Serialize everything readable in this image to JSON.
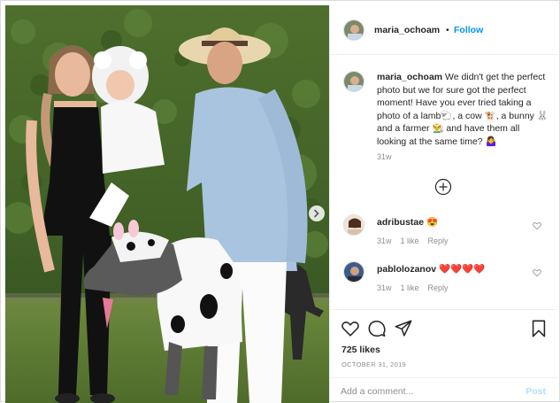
{
  "post": {
    "username": "maria_ochoam",
    "follow_separator": "•",
    "follow_label": "Follow",
    "caption_text": "We didn't get the perfect photo but we for sure got the perfect moment! Have you ever tried taking a photo of a lamb🐑, a cow 🐮, a bunny 🐰 and a farmer 👨‍🌾 and have them all looking at the same time? 🤷‍♀️",
    "caption_time": "31w",
    "likes": "725 likes",
    "date": "OCTOBER 31, 2019"
  },
  "comments": [
    {
      "username": "adribustae",
      "text": "😍",
      "time": "31w",
      "likes": "1 like",
      "reply": "Reply"
    },
    {
      "username": "pablolozanov",
      "text": "❤️❤️❤️❤️",
      "time": "31w",
      "likes": "1 like",
      "reply": "Reply"
    }
  ],
  "add_comment": {
    "placeholder": "Add a comment...",
    "post_label": "Post"
  },
  "icons": {
    "like": "heart-icon",
    "comment": "comment-icon",
    "share": "paper-plane-icon",
    "save": "bookmark-icon",
    "more_comments": "plus-circle-icon",
    "next": "chevron-right-icon"
  },
  "colors": {
    "accent": "#0095f6",
    "post_disabled": "#b2dffc",
    "muted": "#8e8e8e",
    "comment_heart": "#ed4956"
  }
}
